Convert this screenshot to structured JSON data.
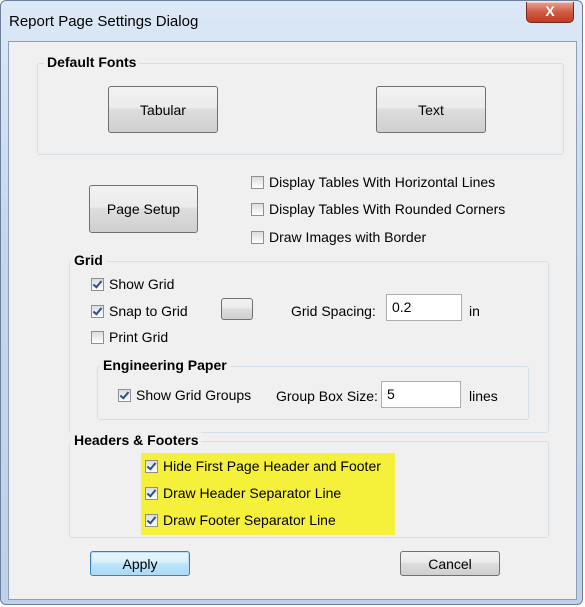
{
  "window": {
    "title": "Report Page Settings Dialog",
    "close_label": "X"
  },
  "default_fonts": {
    "label": "Default Fonts",
    "tabular_button": "Tabular",
    "text_button": "Text"
  },
  "page_setup_button": "Page Setup",
  "options": [
    {
      "label": "Display Tables With Horizontal Lines",
      "checked": false
    },
    {
      "label": "Display Tables With Rounded Corners",
      "checked": false
    },
    {
      "label": "Draw Images with Border",
      "checked": false
    }
  ],
  "grid": {
    "label": "Grid",
    "show_grid": {
      "label": "Show Grid",
      "checked": true
    },
    "snap_to_grid": {
      "label": "Snap to Grid",
      "checked": true
    },
    "print_grid": {
      "label": "Print Grid",
      "checked": false
    },
    "spacing_label": "Grid Spacing:",
    "spacing_value": "0.2",
    "spacing_unit": "in"
  },
  "engineering_paper": {
    "label": "Engineering Paper",
    "show_grid_groups": {
      "label": "Show Grid Groups",
      "checked": true
    },
    "group_box_size_label": "Group Box Size:",
    "group_box_size_value": "5",
    "group_box_size_unit": "lines"
  },
  "headers_footers": {
    "label": "Headers & Footers",
    "highlight_color": "#f5f03a",
    "items": [
      {
        "label": "Hide First Page Header and Footer",
        "checked": true
      },
      {
        "label": "Draw Header Separator Line",
        "checked": true
      },
      {
        "label": "Draw Footer Separator Line",
        "checked": true
      }
    ]
  },
  "footer": {
    "apply_button": "Apply",
    "cancel_button": "Cancel"
  }
}
